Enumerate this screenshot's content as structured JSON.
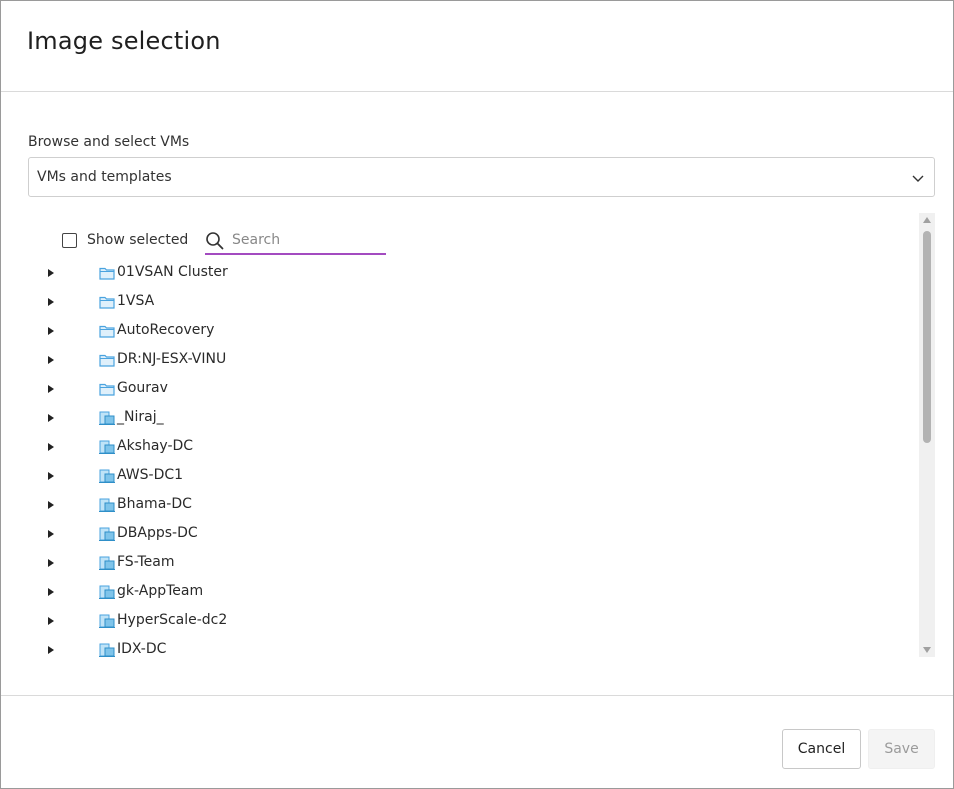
{
  "dialog": {
    "title": "Image selection"
  },
  "browse": {
    "label": "Browse and select VMs",
    "selected": "VMs and templates"
  },
  "toolbar": {
    "show_selected_label": "Show selected",
    "show_selected_checked": false,
    "search_placeholder": "Search",
    "search_value": ""
  },
  "tree": {
    "items": [
      {
        "label": "01VSAN Cluster",
        "icon": "folder-icon"
      },
      {
        "label": "1VSA",
        "icon": "folder-icon"
      },
      {
        "label": "AutoRecovery",
        "icon": "folder-icon"
      },
      {
        "label": "DR:NJ-ESX-VINU",
        "icon": "folder-icon"
      },
      {
        "label": "Gourav",
        "icon": "folder-icon"
      },
      {
        "label": "_Niraj_",
        "icon": "datacenter-icon"
      },
      {
        "label": "Akshay-DC",
        "icon": "datacenter-icon"
      },
      {
        "label": "AWS-DC1",
        "icon": "datacenter-icon"
      },
      {
        "label": "Bhama-DC",
        "icon": "datacenter-icon"
      },
      {
        "label": "DBApps-DC",
        "icon": "datacenter-icon"
      },
      {
        "label": "FS-Team",
        "icon": "datacenter-icon"
      },
      {
        "label": "gk-AppTeam",
        "icon": "datacenter-icon"
      },
      {
        "label": "HyperScale-dc2",
        "icon": "datacenter-icon"
      },
      {
        "label": "IDX-DC",
        "icon": "datacenter-icon"
      }
    ]
  },
  "footer": {
    "cancel_label": "Cancel",
    "save_label": "Save",
    "save_enabled": false
  },
  "colors": {
    "search_underline": "#a34bc0",
    "folder_icon": "#4aa3df"
  }
}
